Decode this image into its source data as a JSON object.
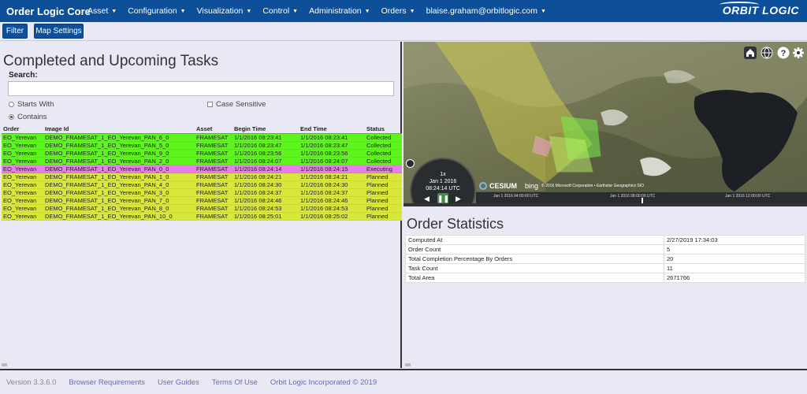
{
  "nav": {
    "brand": "Order Logic Core",
    "items": [
      {
        "label": "Asset",
        "caret": "▼"
      },
      {
        "label": "Configuration",
        "caret": "▼"
      },
      {
        "label": "Visualization",
        "caret": "▼"
      },
      {
        "label": "Control",
        "caret": "▼"
      },
      {
        "label": "Administration",
        "caret": "▼"
      },
      {
        "label": "Orders",
        "caret": "▼"
      },
      {
        "label": "blaise.graham@orbitlogic.com",
        "caret": "▼"
      }
    ],
    "logo": "ORBIT LOGIC"
  },
  "toolbar": {
    "filter_label": "Filter",
    "map_settings_label": "Map Settings"
  },
  "tasks_panel": {
    "title": "Completed and Upcoming Tasks",
    "search_label": "Search:",
    "search_value": "",
    "starts_with_label": "Starts With",
    "contains_label": "Contains",
    "case_sensitive_label": "Case Sensitive",
    "columns": [
      "Order",
      "Image Id",
      "Asset",
      "Begin Time",
      "End Time",
      "Status"
    ],
    "rows": [
      {
        "order": "EO_Yerevan",
        "image_id": "DEMO_FRAMESAT_1_EO_Yerevan_PAN_6_0",
        "asset": "FRAMESAT",
        "begin": "1/1/2016 08:23:41",
        "end": "1/1/2016 08:23:41",
        "status": "Collected"
      },
      {
        "order": "EO_Yerevan",
        "image_id": "DEMO_FRAMESAT_1_EO_Yerevan_PAN_5_0",
        "asset": "FRAMESAT",
        "begin": "1/1/2016 08:23:47",
        "end": "1/1/2016 08:23:47",
        "status": "Collected"
      },
      {
        "order": "EO_Yerevan",
        "image_id": "DEMO_FRAMESAT_1_EO_Yerevan_PAN_9_0",
        "asset": "FRAMESAT",
        "begin": "1/1/2016 08:23:56",
        "end": "1/1/2016 08:23:56",
        "status": "Collected"
      },
      {
        "order": "EO_Yerevan",
        "image_id": "DEMO_FRAMESAT_1_EO_Yerevan_PAN_2_0",
        "asset": "FRAMESAT",
        "begin": "1/1/2016 08:24:07",
        "end": "1/1/2016 08:24:07",
        "status": "Collected"
      },
      {
        "order": "EO_Yerevan",
        "image_id": "DEMO_FRAMESAT_1_EO_Yerevan_PAN_0_0",
        "asset": "FRAMESAT",
        "begin": "1/1/2016 08:24:14",
        "end": "1/1/2016 08:24:15",
        "status": "Executing"
      },
      {
        "order": "EO_Yerevan",
        "image_id": "DEMO_FRAMESAT_1_EO_Yerevan_PAN_1_0",
        "asset": "FRAMESAT",
        "begin": "1/1/2016 08:24:21",
        "end": "1/1/2016 08:24:21",
        "status": "Planned"
      },
      {
        "order": "EO_Yerevan",
        "image_id": "DEMO_FRAMESAT_1_EO_Yerevan_PAN_4_0",
        "asset": "FRAMESAT",
        "begin": "1/1/2016 08:24:30",
        "end": "1/1/2016 08:24:30",
        "status": "Planned"
      },
      {
        "order": "EO_Yerevan",
        "image_id": "DEMO_FRAMESAT_1_EO_Yerevan_PAN_3_0",
        "asset": "FRAMESAT",
        "begin": "1/1/2016 08:24:37",
        "end": "1/1/2016 08:24:37",
        "status": "Planned"
      },
      {
        "order": "EO_Yerevan",
        "image_id": "DEMO_FRAMESAT_1_EO_Yerevan_PAN_7_0",
        "asset": "FRAMESAT",
        "begin": "1/1/2016 08:24:46",
        "end": "1/1/2016 08:24:46",
        "status": "Planned"
      },
      {
        "order": "EO_Yerevan",
        "image_id": "DEMO_FRAMESAT_1_EO_Yerevan_PAN_8_0",
        "asset": "FRAMESAT",
        "begin": "1/1/2016 08:24:53",
        "end": "1/1/2016 08:24:53",
        "status": "Planned"
      },
      {
        "order": "EO_Yerevan",
        "image_id": "DEMO_FRAMESAT_1_EO_Yerevan_PAN_10_0",
        "asset": "FRAMESAT",
        "begin": "1/1/2016 08:25:01",
        "end": "1/1/2016 08:25:02",
        "status": "Planned"
      }
    ]
  },
  "map": {
    "icons": [
      "home-icon",
      "globe-icon",
      "help-icon",
      "settings-icon"
    ],
    "clock_speed": "1x",
    "clock_date": "Jan 1 2016",
    "clock_time": "08:24:14 UTC",
    "cesium_label": "CESIUM",
    "bing_label": "bing",
    "attribution": "© 2016 Microsoft Corporation • Earthstar Geographics SIO",
    "timeline_ticks": [
      "Jan 1 2016 04:00:00 UTC",
      "Jan 1 2016 08:00:00 UTC",
      "Jan 1 2016 12:00:00 UTC"
    ]
  },
  "stats_panel": {
    "title": "Order Statistics",
    "rows": [
      {
        "label": "Computed At",
        "value": "2/27/2019 17:34:03"
      },
      {
        "label": "Order Count",
        "value": "5"
      },
      {
        "label": "Total Completion Percentage By Orders",
        "value": "20"
      },
      {
        "label": "Task Count",
        "value": "11"
      },
      {
        "label": "Total Area",
        "value": "2671766"
      }
    ]
  },
  "footer": {
    "version": "Version 3.3.6.0",
    "links": [
      "Browser Requirements",
      "User Guides",
      "Terms Of Use",
      "Orbit Logic Incorporated © 2019"
    ]
  },
  "colors": {
    "nav_bg": "#0d4f98",
    "collected": "#5ef51e",
    "executing": "#e87ee8",
    "planned": "#d9e63a",
    "page_bg": "#e9e8f5"
  }
}
